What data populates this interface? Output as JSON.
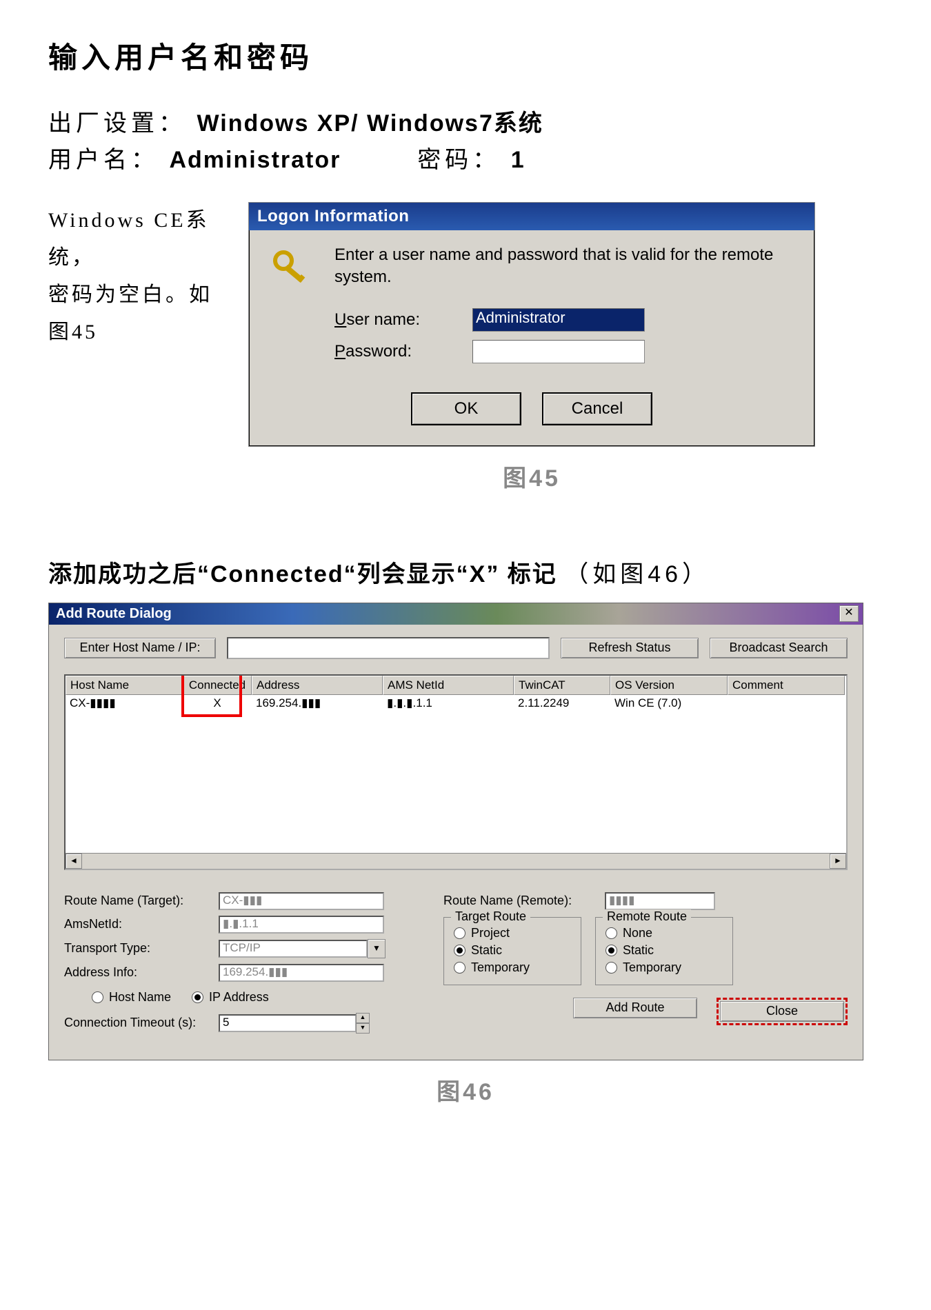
{
  "doc": {
    "heading": "输入用户名和密码",
    "line1_pre": "出厂设置：",
    "line1_bold": "Windows XP/ Windows7系统",
    "line2_user_pre": "用户名：",
    "line2_user_bold": "Administrator",
    "line2_pwd_pre": "密码：",
    "line2_pwd_bold": "1",
    "ce_l1": "Windows CE系统，",
    "ce_l2": "密码为空白。如",
    "ce_l3": "图45",
    "caption45": "图45",
    "heading2_bold": "添加成功之后“Connected“列会显示“X” 标记",
    "heading2_thin": "（如图46）",
    "caption46": "图46"
  },
  "logon": {
    "title": "Logon Information",
    "msg": "Enter a user name and password that is valid for the remote system.",
    "user_lbl_u": "U",
    "user_lbl_rest": "ser name:",
    "pass_lbl_u": "P",
    "pass_lbl_rest": "assword:",
    "user_val": "Administrator",
    "pass_val": "",
    "ok": "OK",
    "cancel": "Cancel"
  },
  "addroute": {
    "title": "Add Route Dialog",
    "close_x": "✕",
    "enter_host_btn": "Enter Host Name / IP:",
    "refresh_btn": "Refresh Status",
    "broadcast_btn": "Broadcast Search",
    "cols": [
      "Host Name",
      "Connected",
      "Address",
      "AMS NetId",
      "TwinCAT",
      "OS Version",
      "Comment"
    ],
    "row": {
      "host": "CX-▮▮▮▮",
      "connected": "X",
      "address": "169.254.▮▮▮",
      "ams": "▮.▮.▮.1.1",
      "twincat": "2.11.2249",
      "os": "Win CE (7.0)",
      "comment": ""
    },
    "route_name_target_lbl": "Route Name (Target):",
    "route_name_target_val": "CX-▮▮▮",
    "amsnetid_lbl": "AmsNetId:",
    "amsnetid_val": "▮.▮.1.1",
    "transport_lbl": "Transport Type:",
    "transport_val": "TCP/IP",
    "addrinfo_lbl": "Address Info:",
    "addrinfo_val": "169.254.▮▮▮",
    "hostname_radio": "Host Name",
    "ipaddr_radio": "IP Address",
    "conn_timeout_lbl": "Connection Timeout (s):",
    "conn_timeout_val": "5",
    "route_name_remote_lbl": "Route Name (Remote):",
    "route_name_remote_val": "▮▮▮▮",
    "target_route_title": "Target Route",
    "remote_route_title": "Remote Route",
    "opt_project": "Project",
    "opt_static": "Static",
    "opt_temporary": "Temporary",
    "opt_none": "None",
    "add_route_btn": "Add Route",
    "close_btn": "Close",
    "scroll_left": "◄",
    "scroll_right": "►"
  }
}
